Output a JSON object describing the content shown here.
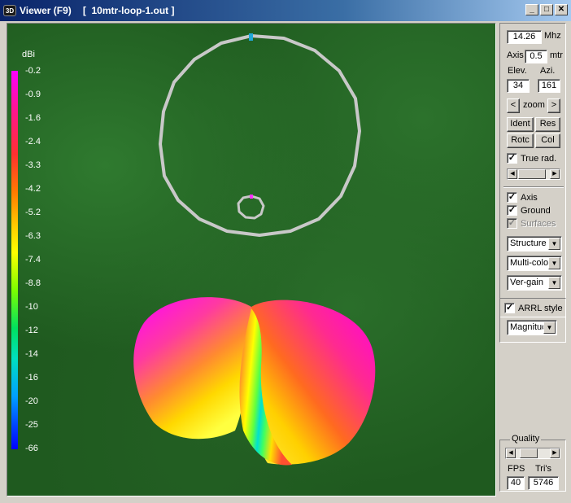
{
  "window": {
    "title": "Viewer (F9)",
    "file": "[  10mtr-loop-1.out ]",
    "icon_text": "3D",
    "buttons": {
      "minimize": "_",
      "maximize": "□",
      "close": "✕"
    }
  },
  "legend": {
    "unit": "dBi",
    "labels": [
      "-0.2",
      "-0.9",
      "-1.6",
      "-2.4",
      "-3.3",
      "-4.2",
      "-5.2",
      "-6.3",
      "-7.4",
      "-8.8",
      "-10",
      "-12",
      "-14",
      "-16",
      "-20",
      "-25",
      "-66"
    ]
  },
  "controls": {
    "frequency": "14.26",
    "frequency_unit": "Mhz",
    "axis_label": "Axis",
    "axis_value": "0.5",
    "axis_unit": "mtr",
    "elev_label": "Elev.",
    "azi_label": "Azi.",
    "elev_value": "34",
    "azi_value": "161",
    "zoom_label": "zoom",
    "zoom_left": "<",
    "zoom_right": ">",
    "ident": "Ident",
    "res": "Res",
    "rotc": "Rotc",
    "col": "Col",
    "true_rad": {
      "label": "True rad.",
      "checked": true
    },
    "axis_check": {
      "label": "Axis",
      "checked": true
    },
    "ground_check": {
      "label": "Ground",
      "checked": true
    },
    "surfaces_check": {
      "label": "Surfaces",
      "checked": true,
      "disabled": true
    },
    "structure_select": "Structure",
    "color_select": "Multi-colo",
    "gain_select": "Ver-gain",
    "arrl_check": {
      "label": "ARRL style",
      "checked": true
    },
    "magnitude_select": "Magnituc",
    "quality_title": "Quality",
    "fps_label": "FPS",
    "tris_label": "Tri's",
    "fps_value": "40",
    "tris_value": "5746"
  },
  "colors": {
    "titlebar_start": "#0a246a",
    "ground": "#1f5a1f",
    "structure": "#c8c8c8",
    "pattern_top": "#ff00ff"
  }
}
